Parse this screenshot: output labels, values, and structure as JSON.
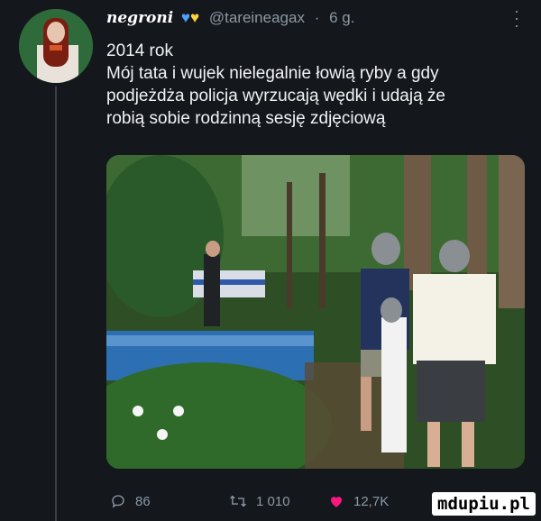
{
  "tweet": {
    "author_name": "negroni",
    "author_emoji": [
      "blue-heart",
      "yellow-heart"
    ],
    "handle": "@tareineagax",
    "time_ago": "6 g.",
    "lines": [
      "2014 rok",
      "Mój tata i wujek nielegalnie łowią ryby a gdy",
      "podjeżdża policja wyrzucają wędki i udają że",
      "robią sobie rodzinną sesję zdjęciową"
    ],
    "replies": "86",
    "retweets": "1 010",
    "likes": "12,7K"
  },
  "watermark": "mdupiu.pl",
  "colors": {
    "background": "#14171c",
    "like": "#f91880",
    "muted": "#8b98a5",
    "blue_heart": "#4aa3ff",
    "yellow_heart": "#ffd43b"
  }
}
